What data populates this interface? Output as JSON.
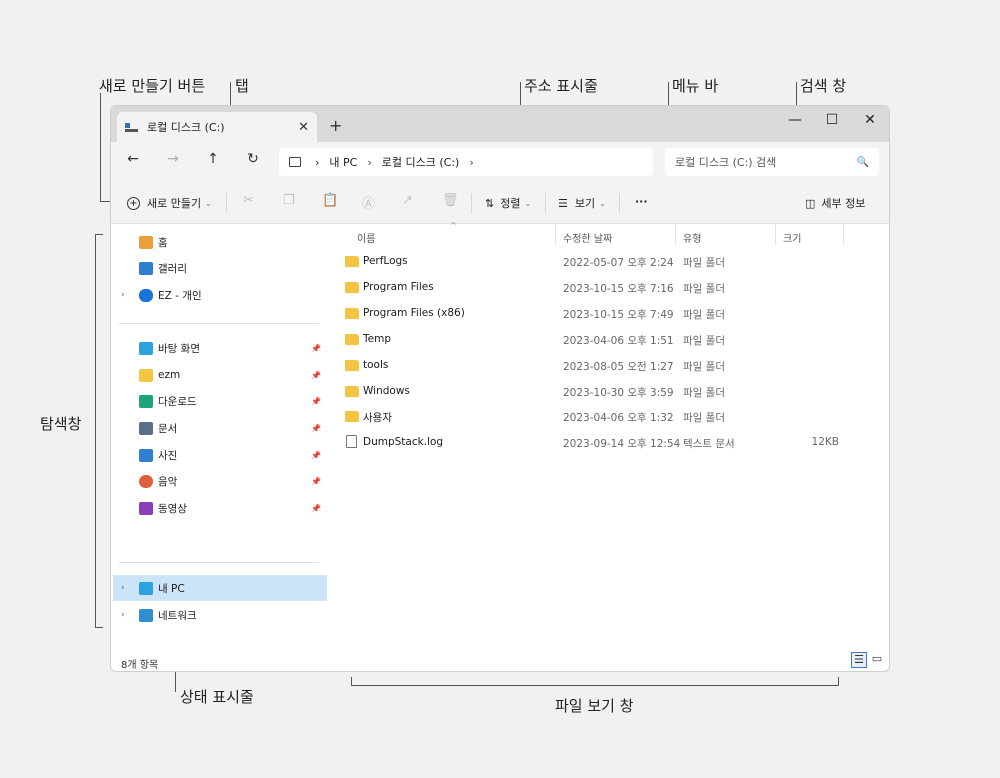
{
  "callouts": {
    "new_button": "새로 만들기 버튼",
    "tab": "탭",
    "address_bar": "주소 표시줄",
    "menu_bar": "메뉴 바",
    "search_box": "검색 창",
    "navigation_pane": "탐색창",
    "status_bar": "상태 표시줄",
    "file_view": "파일 보기 창"
  },
  "window": {
    "tab_title": "로컬 디스크 (C:)",
    "tab_close": "✕",
    "new_tab": "+",
    "minimize": "—",
    "maximize": "☐",
    "close": "✕"
  },
  "nav": {
    "back": "←",
    "forward": "→",
    "up": "↑",
    "refresh": "↻",
    "breadcrumb": [
      "내 PC",
      "로컬 디스크 (C:)"
    ],
    "separator": "›",
    "search_placeholder": "로컬 디스크 (C:) 검색",
    "search_icon": "🔍"
  },
  "toolbar": {
    "new_label": "새로 만들기",
    "cut": "✂",
    "copy": "❐",
    "paste": "📋",
    "rename": "Ⓐ",
    "share": "↗",
    "delete": "🗑",
    "sort_label": "정렬",
    "view_label": "보기",
    "more": "···",
    "details_label": "세부 정보",
    "caret": "⌄"
  },
  "sidebar": {
    "chevron": "›",
    "pin": "📌",
    "items": [
      {
        "label": "홈",
        "icon": "home-icon",
        "color": "#e8a13a"
      },
      {
        "label": "갤러리",
        "icon": "gallery-icon",
        "color": "#2f7fd1"
      },
      {
        "label": "EZ - 개인",
        "icon": "onedrive-icon",
        "color": "#1a73d9"
      },
      {
        "label": "바탕 화면",
        "icon": "desktop-icon",
        "color": "#2aa3de"
      },
      {
        "label": "ezm",
        "icon": "folder-icon",
        "color": "#f4c542"
      },
      {
        "label": "다운로드",
        "icon": "download-icon",
        "color": "#1fa37a"
      },
      {
        "label": "문서",
        "icon": "document-icon",
        "color": "#5b6f8c"
      },
      {
        "label": "사진",
        "icon": "pictures-icon",
        "color": "#2f7fd1"
      },
      {
        "label": "음악",
        "icon": "music-icon",
        "color": "#e0603d"
      },
      {
        "label": "동영상",
        "icon": "video-icon",
        "color": "#8a3fb8"
      },
      {
        "label": "내 PC",
        "icon": "pc-icon",
        "color": "#2aa3de"
      },
      {
        "label": "네트워크",
        "icon": "network-icon",
        "color": "#2f8fd1"
      }
    ]
  },
  "columns": {
    "name": "이름",
    "date": "수정한 날짜",
    "type": "유형",
    "size": "크기",
    "sort_caret": "^"
  },
  "files": [
    {
      "name": "PerfLogs",
      "date": "2022-05-07 오후 2:24",
      "type": "파일 폴더",
      "size": ""
    },
    {
      "name": "Program Files",
      "date": "2023-10-15 오후 7:16",
      "type": "파일 폴더",
      "size": ""
    },
    {
      "name": "Program Files (x86)",
      "date": "2023-10-15 오후 7:49",
      "type": "파일 폴더",
      "size": ""
    },
    {
      "name": "Temp",
      "date": "2023-04-06 오후 1:51",
      "type": "파일 폴더",
      "size": ""
    },
    {
      "name": "tools",
      "date": "2023-08-05 오전 1:27",
      "type": "파일 폴더",
      "size": ""
    },
    {
      "name": "Windows",
      "date": "2023-10-30 오후 3:59",
      "type": "파일 폴더",
      "size": ""
    },
    {
      "name": "사용자",
      "date": "2023-04-06 오후 1:32",
      "type": "파일 폴더",
      "size": ""
    },
    {
      "name": "DumpStack.log",
      "date": "2023-09-14 오후 12:54",
      "type": "텍스트 문서",
      "size": "12KB"
    }
  ],
  "status": {
    "count": "8개 항목",
    "details_view": "☰",
    "tiles_view": "▭"
  }
}
